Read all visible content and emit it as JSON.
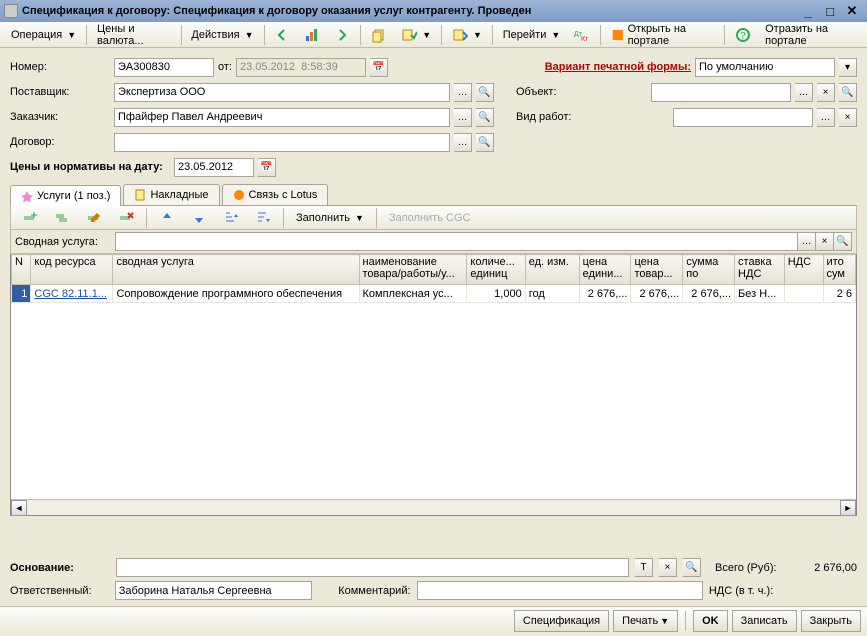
{
  "title": "Спецификация к договору: Спецификация к договору оказания услуг контрагенту. Проведен",
  "toolbar": {
    "operation": "Операция",
    "prices": "Цены и валюта...",
    "actions": "Действия",
    "go": "Перейти",
    "openPortal": "Открыть на портале",
    "reflectPortal": "Отразить на портале"
  },
  "form": {
    "number_lbl": "Номер:",
    "number": "ЭА300830",
    "from_lbl": "от:",
    "date": "23.05.2012  8:58:39",
    "supplier_lbl": "Поставщик:",
    "supplier": "Экспертиза ООО",
    "customer_lbl": "Заказчик:",
    "customer": "Пфайфер Павел Андреевич",
    "contract_lbl": "Договор:",
    "contract": "",
    "printVariant_lbl": "Вариант печатной формы:",
    "printVariant": "По умолчанию",
    "object_lbl": "Объект:",
    "object": "",
    "workType_lbl": "Вид работ:",
    "workType": "",
    "pricesDate_lbl": "Цены и нормативы на дату:",
    "pricesDate": "23.05.2012"
  },
  "tabs": {
    "t1": "Услуги (1 поз.)",
    "t2": "Накладные",
    "t3": "Связь с Lotus"
  },
  "gridtb": {
    "fill": "Заполнить",
    "fillCGC": "Заполнить CGC"
  },
  "svod": {
    "lbl": "Сводная услуга:",
    "val": ""
  },
  "cols": {
    "n": "N",
    "code": "код ресурса",
    "svod": "сводная услуга",
    "name": "наименование товара/работы/у...",
    "qty": "количе... единиц",
    "unit": "ед. изм.",
    "price1": "цена едини...",
    "price2": "цена товар...",
    "sum": "сумма по",
    "vatRate": "ставка НДС",
    "vat": "НДС",
    "total": "ито сум"
  },
  "rows": [
    {
      "n": "1",
      "code": "CGC 82.11.1...",
      "svod": "Сопровождение программного обеспечения",
      "name": "Комплексная ус...",
      "qty": "1,000",
      "unit": "год",
      "price1": "2 676,...",
      "price2": "2 676,...",
      "sum": "2 676,...",
      "vatRate": "Без Н...",
      "vat": "",
      "total": "2 6"
    }
  ],
  "footer": {
    "basis_lbl": "Основание:",
    "basis": "",
    "resp_lbl": "Ответственный:",
    "resp": "Заборина Наталья Сергеевна",
    "comment_lbl": "Комментарий:",
    "comment": "",
    "total_lbl": "Всего (Руб):",
    "total": "2 676,00",
    "vatIncl_lbl": "НДС (в т. ч.):",
    "vatIncl": ""
  },
  "bottom": {
    "spec": "Спецификация",
    "print": "Печать",
    "ok": "OK",
    "save": "Записать",
    "close": "Закрыть"
  }
}
